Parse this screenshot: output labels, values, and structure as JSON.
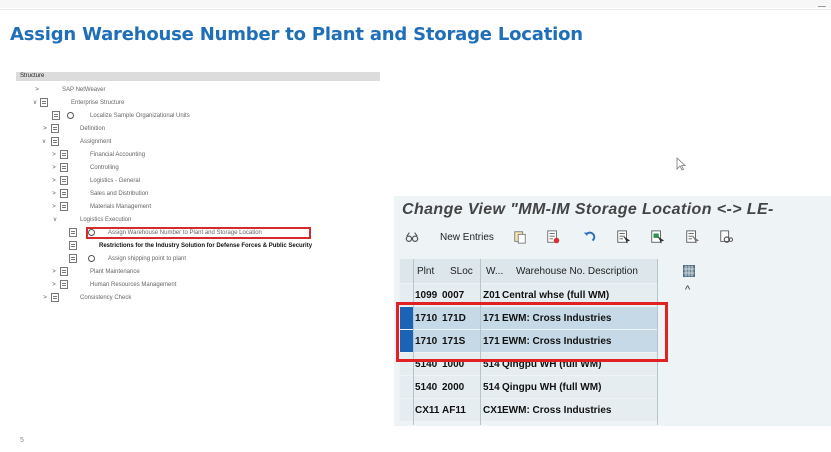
{
  "slide": {
    "title": "Assign Warehouse Number to Plant and Storage Location",
    "page_number": "5"
  },
  "tree": {
    "header": "Structure",
    "items": [
      {
        "label": "SAP NetWeaver",
        "expander": ">"
      },
      {
        "label": "Enterprise Structure",
        "expander": "v"
      },
      {
        "label": "Localize Sample Organizational Units"
      },
      {
        "label": "Definition",
        "expander": ">"
      },
      {
        "label": "Assignment",
        "expander": "v"
      },
      {
        "label": "Financial Accounting",
        "expander": ">"
      },
      {
        "label": "Controlling",
        "expander": ">"
      },
      {
        "label": "Logistics - General",
        "expander": ">"
      },
      {
        "label": "Sales and Distribution",
        "expander": ">"
      },
      {
        "label": "Materials Management",
        "expander": ">"
      },
      {
        "label": "Logistics Execution",
        "expander": "v"
      },
      {
        "label": "Assign Warehouse Number to Plant and Storage Location"
      },
      {
        "label": "Restrictions for the Industry Solution for Defense Forces & Public Security"
      },
      {
        "label": "Assign shipping point to plant"
      },
      {
        "label": "Plant Maintenance",
        "expander": ">"
      },
      {
        "label": "Human Resources Management",
        "expander": ">"
      },
      {
        "label": "Consistency Check",
        "expander": ">"
      }
    ]
  },
  "change_view": {
    "title": "Change View \"MM-IM Storage Location <-> LE-",
    "toolbar": {
      "new_entries_label": "New Entries"
    },
    "columns": [
      "Plnt",
      "SLoc",
      "W...",
      "Warehouse No. Description"
    ],
    "rows": [
      {
        "plnt": "1099",
        "sloc": "0007",
        "wh": "Z01",
        "desc": "Central whse (full WM)",
        "selected": false
      },
      {
        "plnt": "1710",
        "sloc": "171D",
        "wh": "171",
        "desc": "EWM: Cross Industries",
        "selected": true
      },
      {
        "plnt": "1710",
        "sloc": "171S",
        "wh": "171",
        "desc": "EWM: Cross Industries",
        "selected": true
      },
      {
        "plnt": "5140",
        "sloc": "1000",
        "wh": "514",
        "desc": "Qingpu WH (full WM)",
        "selected": false
      },
      {
        "plnt": "5140",
        "sloc": "2000",
        "wh": "514",
        "desc": "Qingpu WH (full WM)",
        "selected": false
      },
      {
        "plnt": "CX11",
        "sloc": "AF11",
        "wh": "CX1",
        "desc": "EWM: Cross Industries",
        "selected": false
      }
    ],
    "scroll_up_glyph": "^"
  },
  "colors": {
    "title_blue": "#1f6fb8",
    "highlight_red": "#e02222",
    "selection_blue": "#1b63b5"
  }
}
